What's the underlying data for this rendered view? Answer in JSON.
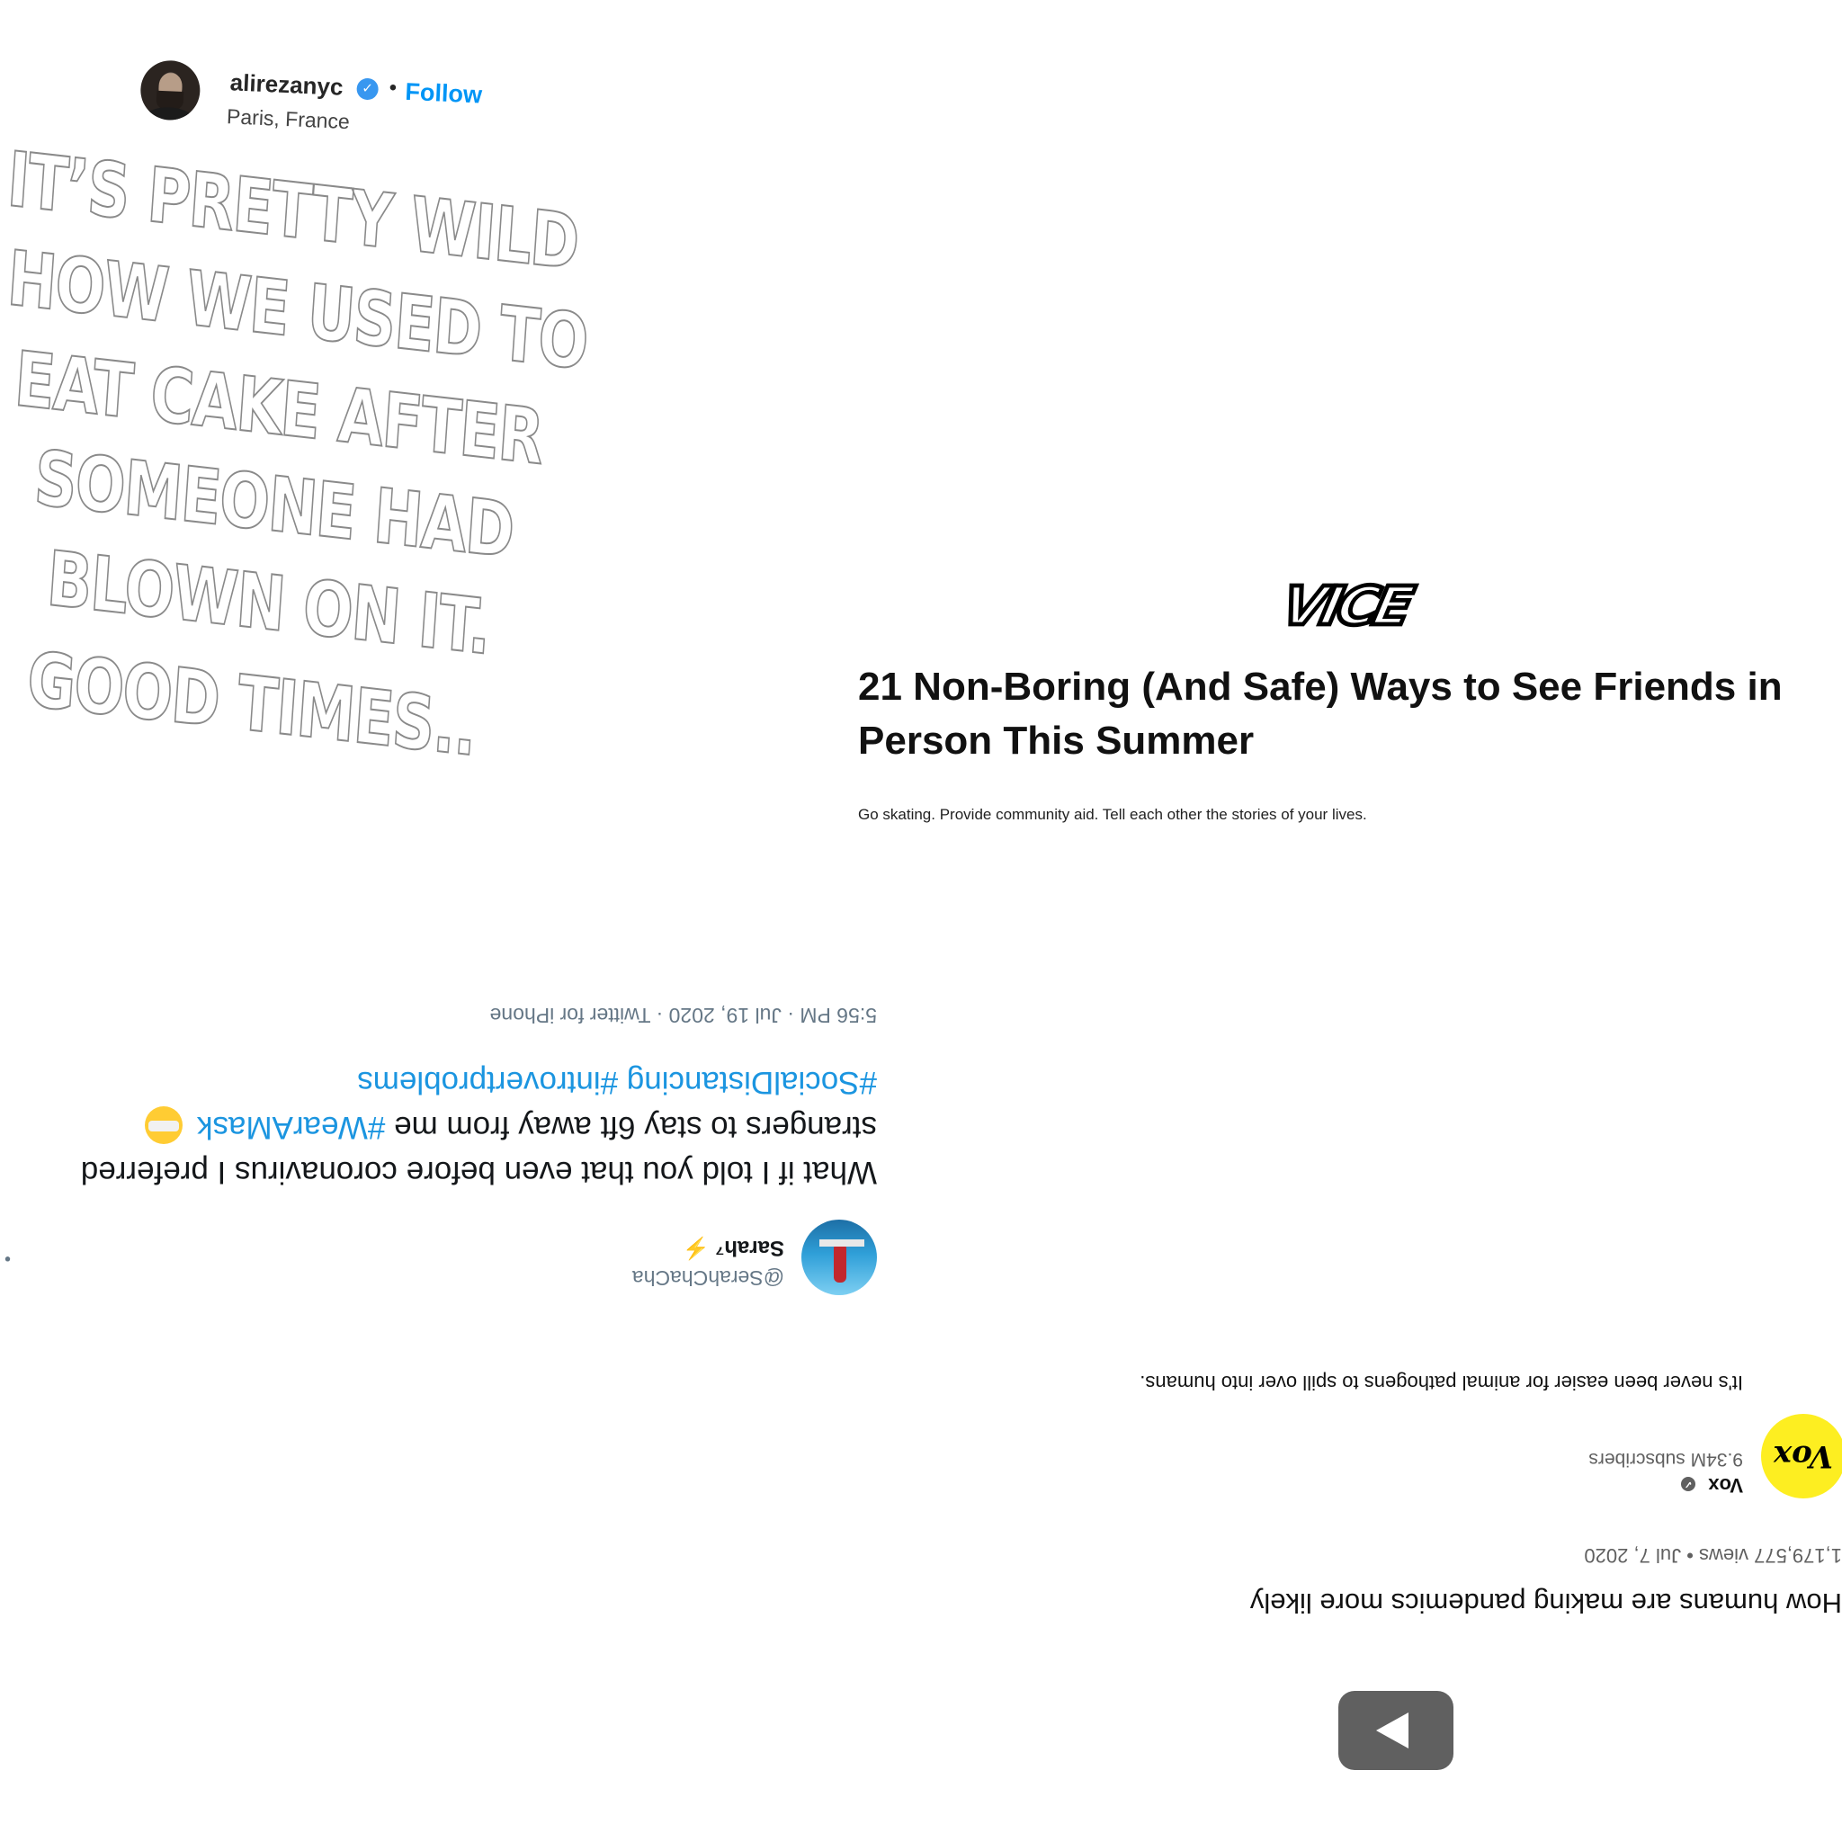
{
  "instagram": {
    "username": "alirezanyc",
    "verified_icon": "✓",
    "separator": "•",
    "follow_label": "Follow",
    "location": "Paris, France",
    "text_lines": [
      "IT’S PRETTY WILD",
      "HOW WE USED TO",
      "EAT CAKE AFTER",
      "SOMEONE HAD",
      "BLOWN ON IT.",
      "GOOD TIMES.."
    ]
  },
  "vice": {
    "logo": "VICE",
    "title": "21 Non-Boring (And Safe) Ways to See Friends in Person This Summer",
    "dek": "Go skating. Provide community aid. Tell each other the stories of your lives."
  },
  "tweet": {
    "name": "Sarah⁷",
    "bolt": "⚡",
    "handle": "@SerahChaCha",
    "more": "•",
    "body_text": "What if I told you that even before coronavirus I preferred strangers to stay 6ft away from me",
    "tag_mask": "#WearAMask",
    "tags_line": "#SocialDistancing #introvertproblems",
    "meta": "5:56 PM · Jul 19, 2020 · Twitter for iPhone"
  },
  "youtube": {
    "title": "How humans are making pandemics more likely",
    "meta": "1,179,577 views • Jul 7, 2020",
    "channel_avatar": "Vox",
    "channel_name": "Vox",
    "verified_icon": "✓",
    "subscribers": "9.34M subscribers",
    "description": "It's never been easier for animal pathogens to spill over into humans."
  }
}
